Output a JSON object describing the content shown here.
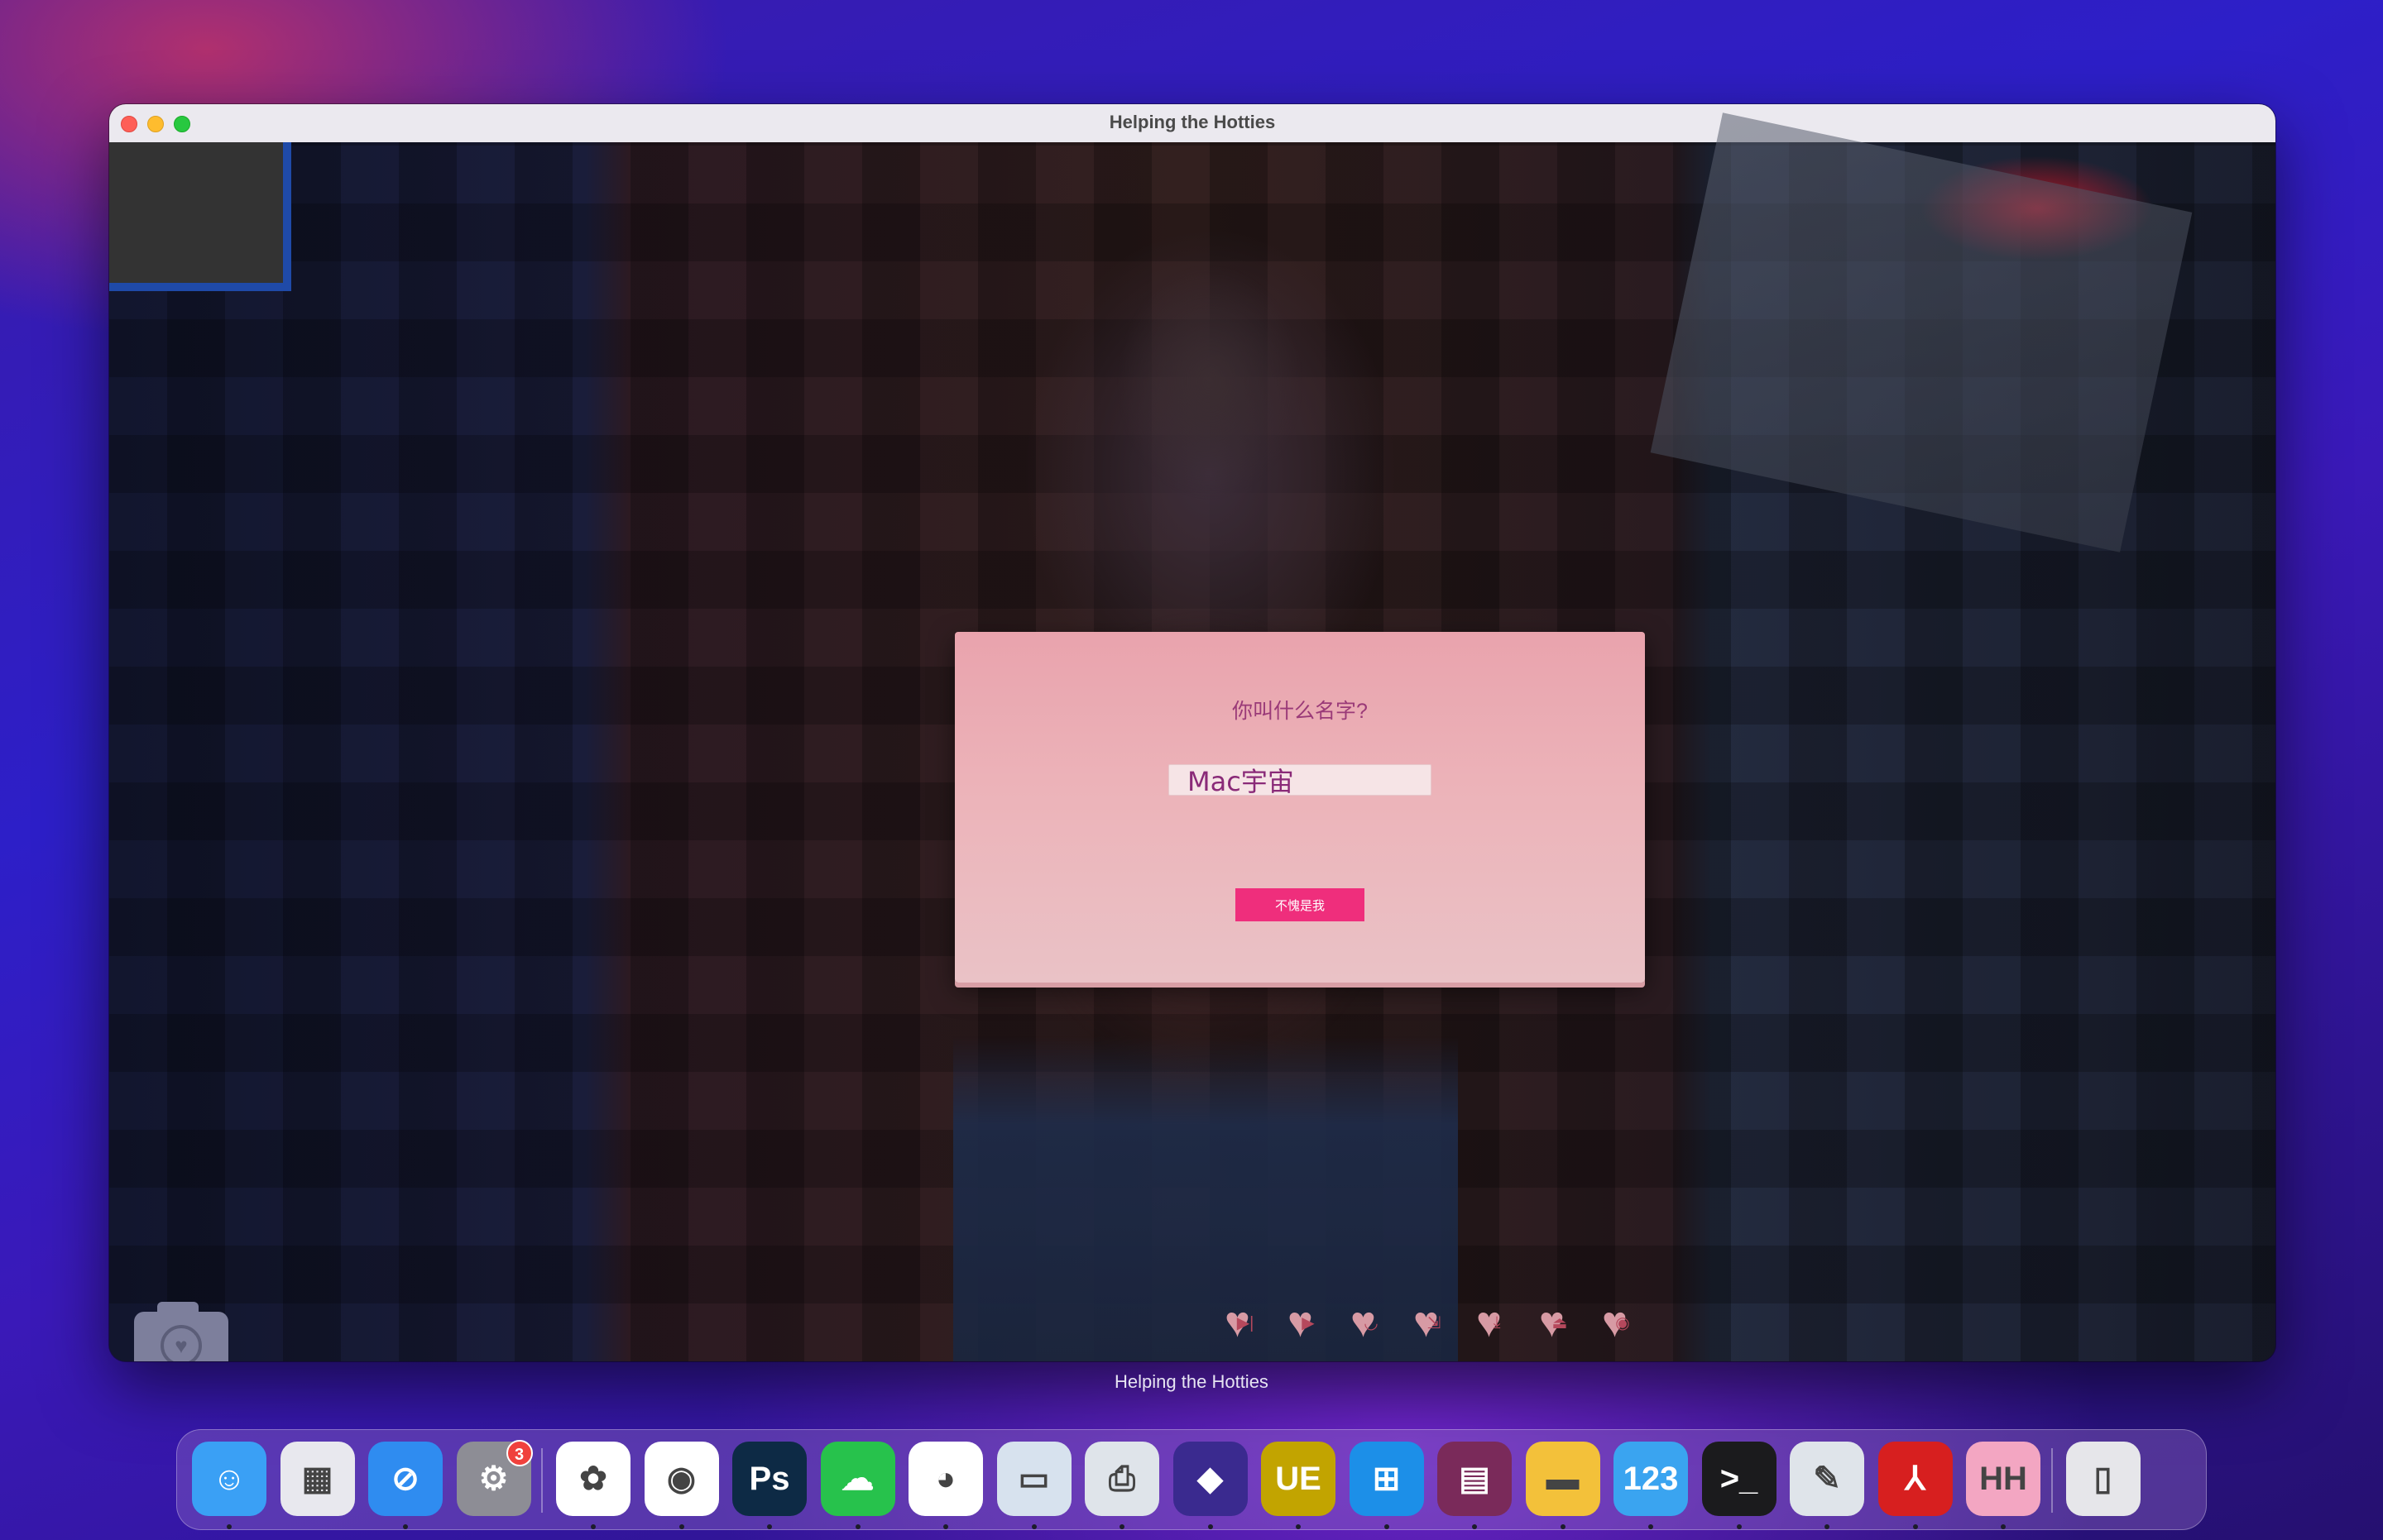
{
  "window": {
    "title": "Helping the Hotties"
  },
  "dialog": {
    "question": "你叫什么名字?",
    "name_value": "Mac宇宙",
    "confirm_label": "不愧是我"
  },
  "quick_menu": {
    "buttons": [
      {
        "icon": "skip-icon",
        "glyph": "▶|"
      },
      {
        "icon": "play-icon",
        "glyph": "▶"
      },
      {
        "icon": "lips-icon",
        "glyph": "◡"
      },
      {
        "icon": "load-icon",
        "glyph": "⇲"
      },
      {
        "icon": "save-icon",
        "glyph": "⤓"
      },
      {
        "icon": "upload-icon",
        "glyph": "⏏"
      },
      {
        "icon": "eye-icon",
        "glyph": "◉"
      }
    ]
  },
  "hover_label": "Helping the Hotties",
  "dock": {
    "apps": [
      {
        "name": "Finder",
        "icon": "finder-icon",
        "color": "#3aa0f5",
        "glyph": "☺",
        "running": true
      },
      {
        "name": "Launchpad",
        "icon": "launchpad-icon",
        "color": "#e8e8ee",
        "glyph": "▦",
        "running": false
      },
      {
        "name": "Safari",
        "icon": "safari-icon",
        "color": "#2f8cf0",
        "glyph": "⊘",
        "running": true
      },
      {
        "name": "System Settings",
        "icon": "settings-icon",
        "color": "#8d8d95",
        "glyph": "⚙",
        "running": false,
        "badge": "3"
      },
      {
        "name": "Baidu Netdisk",
        "icon": "cloud-icon",
        "color": "#ffffff",
        "glyph": "✿",
        "running": true
      },
      {
        "name": "Chrome",
        "icon": "chrome-icon",
        "color": "#ffffff",
        "glyph": "◉",
        "running": true
      },
      {
        "name": "Photoshop",
        "icon": "photoshop-icon",
        "color": "#0d2a45",
        "glyph": "Ps",
        "running": true
      },
      {
        "name": "WeChat",
        "icon": "wechat-icon",
        "color": "#27c24c",
        "glyph": "☁",
        "running": true
      },
      {
        "name": "QQ",
        "icon": "qq-icon",
        "color": "#ffffff",
        "glyph": "◕",
        "running": true
      },
      {
        "name": "Parallels",
        "icon": "parallels-icon",
        "color": "#d7e2ee",
        "glyph": "▭",
        "running": true
      },
      {
        "name": "Printer",
        "icon": "printer-icon",
        "color": "#dfe4ea",
        "glyph": "⎙",
        "running": true
      },
      {
        "name": "Affinity",
        "icon": "diamond-icon",
        "color": "#3a2a8f",
        "glyph": "◆",
        "running": true
      },
      {
        "name": "UltraEdit",
        "icon": "ue-icon",
        "color": "#c2a400",
        "glyph": "UE",
        "running": true
      },
      {
        "name": "Windows",
        "icon": "windows-icon",
        "color": "#1c8fe8",
        "glyph": "⊞",
        "running": true
      },
      {
        "name": "WinRAR",
        "icon": "winrar-icon",
        "color": "#7a2a5a",
        "glyph": "▤",
        "running": true
      },
      {
        "name": "Files",
        "icon": "folder-icon",
        "color": "#f3c13a",
        "glyph": "▬",
        "running": true
      },
      {
        "name": "Numbers",
        "icon": "numbers-icon",
        "color": "#3aa4f0",
        "glyph": "123",
        "running": true
      },
      {
        "name": "Terminal",
        "icon": "terminal-icon",
        "color": "#1b1b1d",
        "glyph": ">_",
        "running": true
      },
      {
        "name": "Preview",
        "icon": "preview-icon",
        "color": "#dfe4ea",
        "glyph": "✎",
        "running": true
      },
      {
        "name": "Acrobat",
        "icon": "acrobat-icon",
        "color": "#d71f1f",
        "glyph": "⅄",
        "running": true
      },
      {
        "name": "Helping the Hotties",
        "icon": "game-icon",
        "color": "#f3a6c2",
        "glyph": "HH",
        "running": true
      },
      {
        "name": "Trash",
        "icon": "trash-icon",
        "color": "#e6e6ea",
        "glyph": "▯",
        "running": false
      }
    ]
  }
}
